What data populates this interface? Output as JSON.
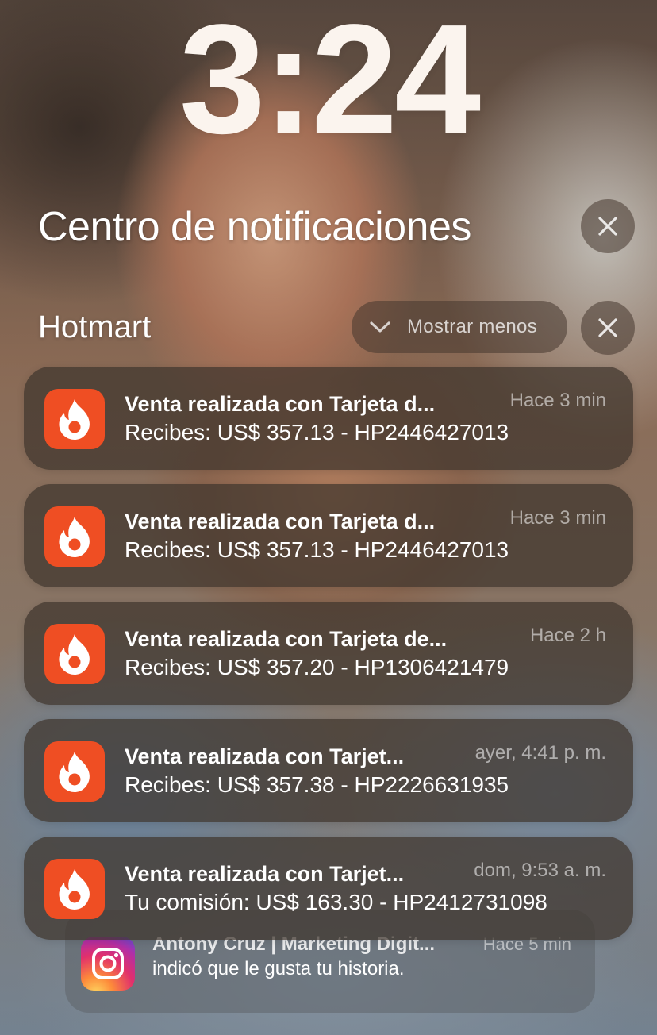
{
  "lockscreen": {
    "time": "3:24"
  },
  "notification_center": {
    "title": "Centro de notificaciones",
    "close_icon": "close-icon"
  },
  "group": {
    "app_name": "Hotmart",
    "show_less_label": "Mostrar menos",
    "show_less_icon": "chevron-down-icon",
    "close_icon": "close-icon"
  },
  "notifications": [
    {
      "app": "Hotmart",
      "icon": "hotmart-flame-icon",
      "title": "Venta realizada con Tarjeta d...",
      "time": "Hace 3 min",
      "body": "Recibes: US$ 357.13 - HP2446427013"
    },
    {
      "app": "Hotmart",
      "icon": "hotmart-flame-icon",
      "title": "Venta realizada con Tarjeta d...",
      "time": "Hace 3 min",
      "body": "Recibes: US$ 357.13 - HP2446427013"
    },
    {
      "app": "Hotmart",
      "icon": "hotmart-flame-icon",
      "title": "Venta realizada con Tarjeta de...",
      "time": "Hace 2 h",
      "body": "Recibes: US$ 357.20 - HP1306421479"
    },
    {
      "app": "Hotmart",
      "icon": "hotmart-flame-icon",
      "title": "Venta realizada con Tarjet...",
      "time": "ayer, 4:41 p. m.",
      "body": "Recibes: US$ 357.38 - HP2226631935"
    },
    {
      "app": "Hotmart",
      "icon": "hotmart-flame-icon",
      "title": "Venta realizada con Tarjet...",
      "time": "dom, 9:53 a. m.",
      "body": "Tu comisión: US$ 163.30 - HP2412731098"
    }
  ],
  "stacked_notification": {
    "app": "Instagram",
    "icon": "instagram-icon",
    "title": "Antony Cruz | Marketing Digit...",
    "time": "Hace 5 min",
    "body": "indicó que le gusta tu historia."
  }
}
